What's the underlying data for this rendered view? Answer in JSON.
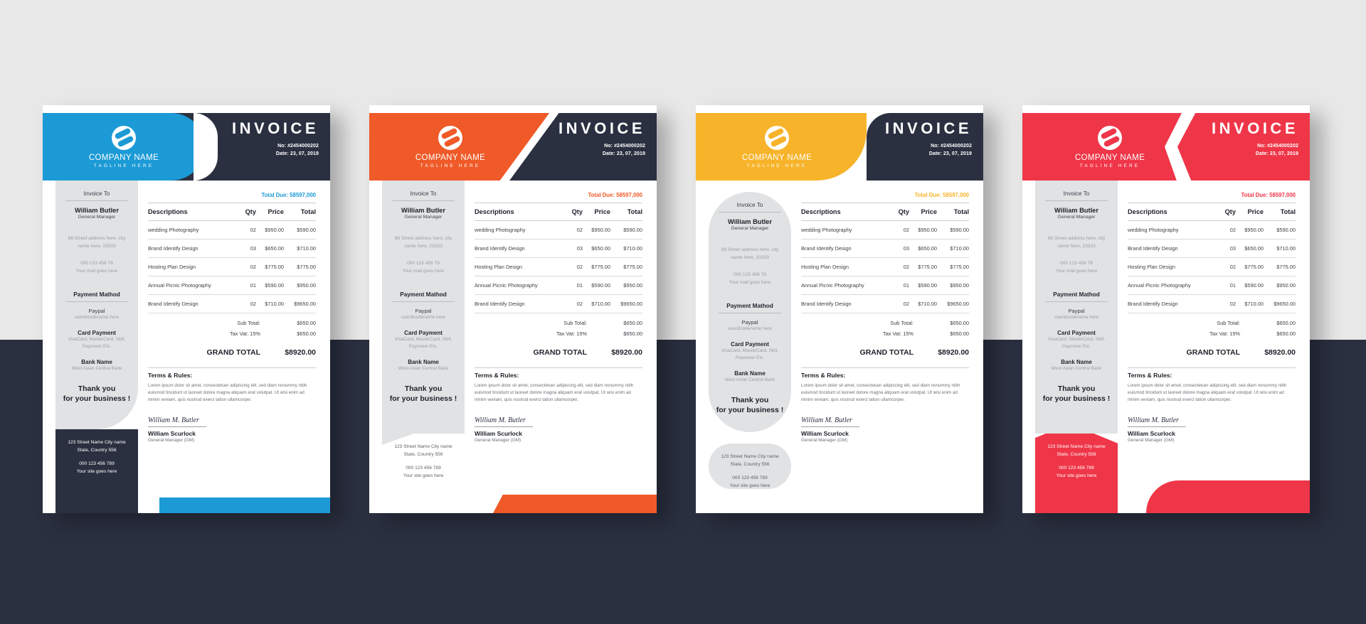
{
  "meta": {
    "background": "#e8e8e8",
    "dark_band": "#2b3041"
  },
  "brand": {
    "company_name": "COMPANY NAME",
    "tagline": "TAGLINE HERE",
    "logo_icon": "company-s-mark-icon"
  },
  "header": {
    "title": "INVOICE",
    "number_label": "No: #2454000202",
    "date_label": "Date: 23, 07, 2019"
  },
  "sidebar": {
    "invoice_to_label": "Invoice To",
    "client_name": "William Butler",
    "client_role": "General Manager",
    "address_line1": "88 Street address here, city",
    "address_line2": "name here, 23333",
    "phone": "000 123 456 78",
    "mail": "Your mail goes here",
    "payment_method_label": "Payment Mathod",
    "paypal_label": "Paypal",
    "paypal_value": "useridcodename here",
    "card_payment_label": "Card Payment",
    "card_payment_value1": "VisaCard, MasterCard, Skill,",
    "card_payment_value2": "Payoneer Etc.",
    "bank_name_label": "Bank Name",
    "bank_name_value": "West Asian Central Bank",
    "thanks_line1": "Thank you",
    "thanks_line2": "for your business !"
  },
  "footer": {
    "address_line1": "123 Street Name City name",
    "address_line2": "State, Country 556",
    "phone": "000 123 456 789",
    "site": "Your site goes here"
  },
  "table": {
    "total_due": "Total Due: 58597,000",
    "columns": [
      "Descriptions",
      "Qty",
      "Price",
      "Total"
    ],
    "rows": [
      {
        "desc": "wedding Photography",
        "qty": "02",
        "price": "$950.00",
        "total": "$590.00"
      },
      {
        "desc": "Brand Identify Design",
        "qty": "03",
        "price": "$650.00",
        "total": "$710.00"
      },
      {
        "desc": "Hosting Plan Design",
        "qty": "02",
        "price": "$775.00",
        "total": "$775.00"
      },
      {
        "desc": "Annual Picnic Photography",
        "qty": "01",
        "price": "$590.00",
        "total": "$950.00"
      },
      {
        "desc": "Brand Identify Design",
        "qty": "02",
        "price": "$710.00",
        "total": "$9650.00"
      }
    ],
    "sub_total_label": "Sub Total:",
    "sub_total_value": "$650.00",
    "tax_label": "Tax Vat: 15%",
    "tax_value": "$650.00",
    "grand_total_label": "GRAND TOTAL",
    "grand_total_value": "$8920.00"
  },
  "terms": {
    "heading": "Terms & Rules:",
    "body": "Lorem ipsum dolor sit amet, consectetuer adipiscing elit, sed diam nonummy nibh euismod tincidunt ut laoreet dolore magna aliquam erat volutpat. Ut wisi enim ad minim veniam, quis nostrud exerci tation ullamcorper.",
    "signature_script": "William M. Butler",
    "signer_name": "William Scurlock",
    "signer_role": "General Manager (GM)"
  },
  "variants": [
    {
      "id": "card1",
      "accent_name": "blue",
      "accent": "#1b9ad6",
      "due_color": "#1b9ad6"
    },
    {
      "id": "card2",
      "accent_name": "orange",
      "accent": "#ef5a28",
      "due_color": "#ef5a28"
    },
    {
      "id": "card3",
      "accent_name": "yellow",
      "accent": "#f7b329",
      "due_color": "#f7b329"
    },
    {
      "id": "card4",
      "accent_name": "red",
      "accent": "#ef3648",
      "due_color": "#ef3648"
    }
  ]
}
